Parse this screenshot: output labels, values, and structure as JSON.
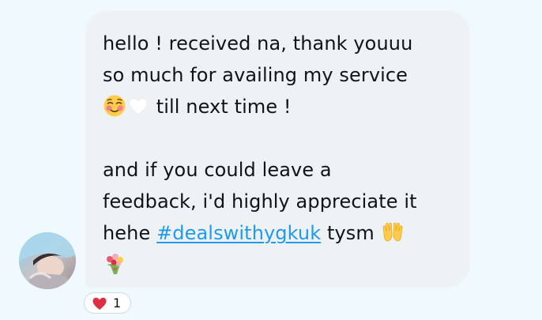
{
  "message": {
    "line1": "hello ! received na, thank youuu",
    "line2": "so much for availing my service",
    "line3_text": "till next time !",
    "line4": "and if you could leave a",
    "line5": "feedback, i'd highly appreciate it",
    "line6_before": "hehe ",
    "hashtag": "#dealswithygkuk",
    "line6_after": " tysm",
    "emoji_icons": [
      "smiling-face-with-blush-icon",
      "white-heart-icon",
      "raising-hands-icon",
      "bouquet-icon"
    ]
  },
  "reaction": {
    "icon": "red-heart-icon",
    "count": "1"
  },
  "colors": {
    "background": "#f0f9fe",
    "bubble": "#eff2f4",
    "text": "#0f1419",
    "link": "#1d9bf0",
    "heart": "#e0245e"
  }
}
